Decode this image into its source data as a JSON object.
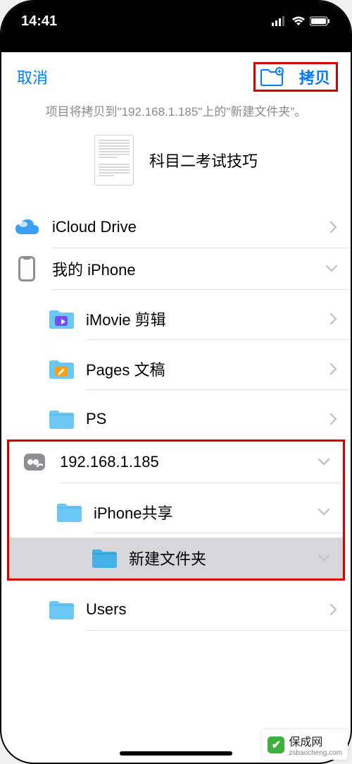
{
  "status": {
    "time": "14:41"
  },
  "nav": {
    "cancel": "取消",
    "copy": "拷贝"
  },
  "subtitle": "项目将拷贝到\"192.168.1.185\"上的\"新建文件夹\"。",
  "doc": {
    "title": "科目二考试技巧"
  },
  "locations": {
    "icloud": "iCloud Drive",
    "iphone": "我的 iPhone",
    "imovie": "iMovie 剪辑",
    "pages": "Pages 文稿",
    "ps": "PS",
    "server": "192.168.1.185",
    "share": "iPhone共享",
    "newfolder": "新建文件夹",
    "users": "Users"
  },
  "watermark": {
    "name": "保成网",
    "url": "zsbaocheng.com"
  },
  "colors": {
    "accent": "#007aff",
    "folder": "#6cc7f4",
    "folder_dark": "#44b0e8",
    "imovie": "#6b52f2",
    "pages": "#ff9f0a",
    "server_icon": "#8e8e93"
  }
}
